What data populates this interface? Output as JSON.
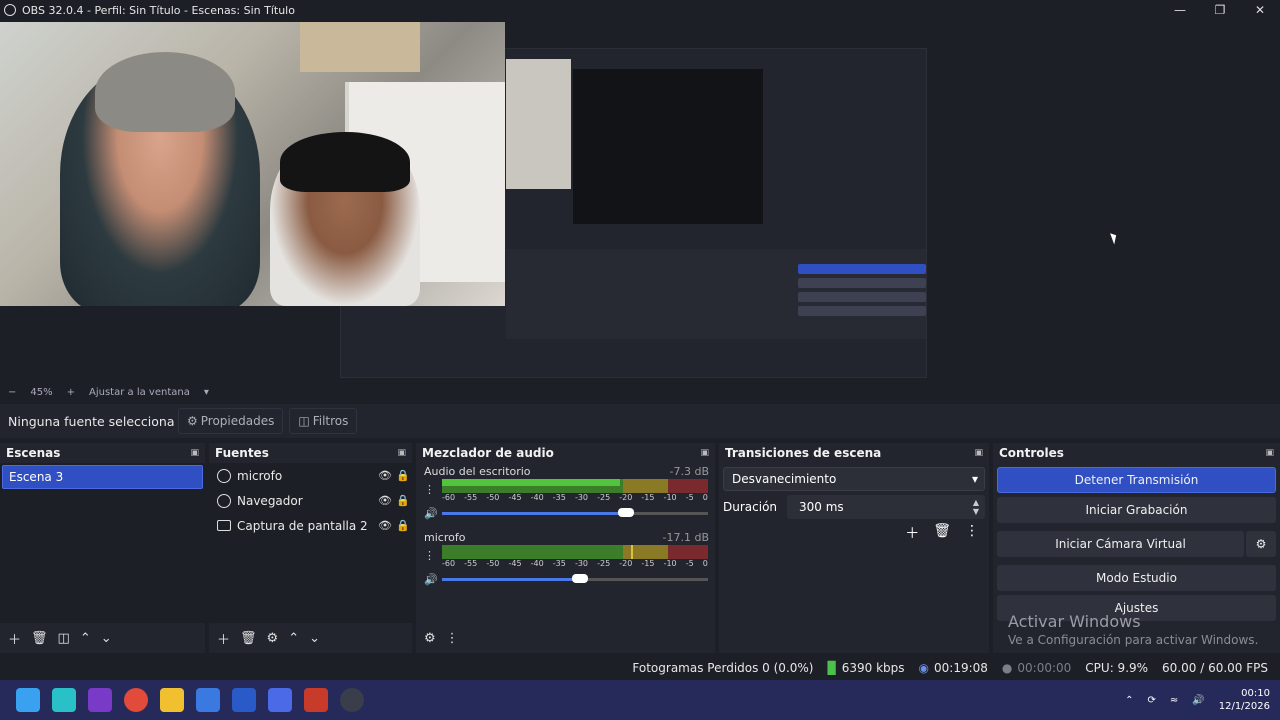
{
  "window": {
    "title": "OBS 32.0.4 - Perfil: Sin Título - Escenas: Sin Título"
  },
  "preview": {
    "zoom_minus": "−",
    "zoom_level": "45%",
    "zoom_plus": "+",
    "fit_label": "Ajustar a la ventana"
  },
  "source_bar": {
    "no_selection": "Ninguna fuente selecciona",
    "properties": "Propiedades",
    "filters": "Filtros"
  },
  "scenes": {
    "title": "Escenas",
    "items": [
      "Escena 3"
    ]
  },
  "sources": {
    "title": "Fuentes",
    "items": [
      {
        "label": "microfo",
        "icon": "globe-icon"
      },
      {
        "label": "Navegador",
        "icon": "globe-icon"
      },
      {
        "label": "Captura de pantalla 2",
        "icon": "monitor-icon"
      }
    ]
  },
  "mixer": {
    "title": "Mezclador de audio",
    "ticks": [
      "-60",
      "-55",
      "-50",
      "-45",
      "-40",
      "-35",
      "-30",
      "-25",
      "-20",
      "-15",
      "-10",
      "-5",
      "0"
    ],
    "tracks": [
      {
        "name": "Audio del escritorio",
        "db": "-7.3 dB",
        "volume": 0.69
      },
      {
        "name": "microfo",
        "db": "-17.1 dB",
        "volume": 0.52
      }
    ]
  },
  "transitions": {
    "title": "Transiciones de escena",
    "selected": "Desvanecimiento",
    "duration_label": "Duración",
    "duration_value": "300 ms"
  },
  "controls": {
    "title": "Controles",
    "stop_stream": "Detener Transmisión",
    "start_record": "Iniciar Grabación",
    "start_vcam": "Iniciar Cámara Virtual",
    "studio_mode": "Modo Estudio",
    "settings": "Ajustes"
  },
  "activation": {
    "title": "Activar Windows",
    "subtitle": "Ve a Configuración para activar Windows."
  },
  "status": {
    "dropped": "Fotogramas Perdidos 0 (0.0%)",
    "bitrate": "6390 kbps",
    "stream_time": "00:19:08",
    "record_time": "00:00:00",
    "cpu": "CPU: 9.9%",
    "fps": "60.00 / 60.00 FPS"
  },
  "clock": {
    "time": "00:10",
    "date": "12/1/2026"
  },
  "colors": {
    "accent": "#2f4fc2",
    "taskbar": "#262a5a",
    "bg": "#1d1f26"
  }
}
